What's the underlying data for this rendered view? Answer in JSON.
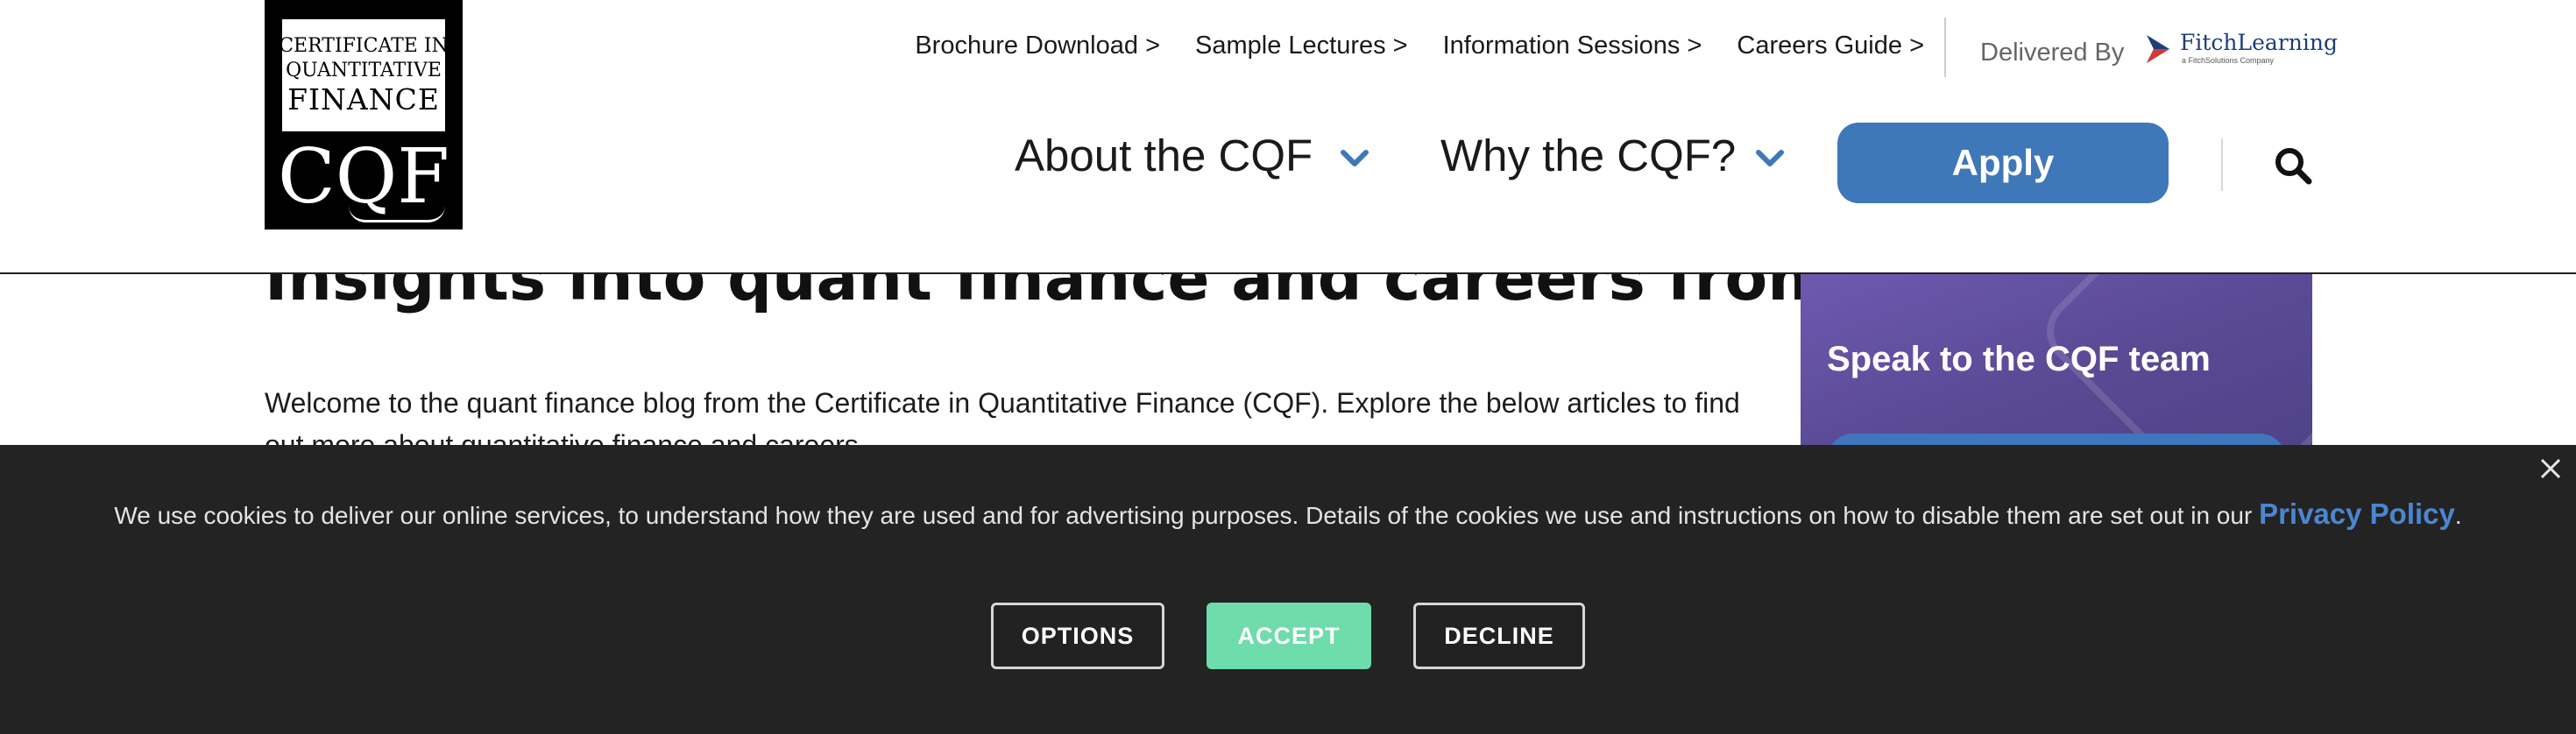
{
  "content": {
    "headline": "Insights into quant finance and careers from the CQF",
    "intro": "Welcome to the quant finance blog from the Certificate in Quantitative Finance (CQF). Explore the below articles to find out more about quantitative finance and careers.",
    "side_card_title": "Speak to the CQF team"
  },
  "header": {
    "logo": {
      "line1": "CERTIFICATE IN",
      "line2": "QUANTITATIVE",
      "line3": "FINANCE",
      "mark": "CQF"
    },
    "top_links": [
      "Brochure Download >",
      "Sample Lectures >",
      "Information Sessions >",
      "Careers Guide >"
    ],
    "delivered_by": "Delivered By",
    "partner": {
      "name": "FitchLearning",
      "tagline": "a FitchSolutions Company"
    },
    "nav": [
      {
        "label": "About the CQF",
        "icon": "chevron-down-icon"
      },
      {
        "label": "Why the CQF?",
        "icon": "chevron-down-icon"
      }
    ],
    "apply_label": "Apply",
    "search_icon": "search-icon"
  },
  "cookie_banner": {
    "text": "We use cookies to deliver our online services, to understand how they are used and for advertising purposes. Details of the cookies we use and instructions on how to disable them are set out in our",
    "link": "Privacy Policy",
    "suffix": ".",
    "buttons": {
      "options": "OPTIONS",
      "accept": "ACCEPT",
      "decline": "DECLINE"
    },
    "close_icon": "close-icon"
  },
  "colors": {
    "brand_blue": "#3f78b9",
    "accent_purple": "#6a57ab",
    "accept_green": "#6edcab",
    "banner_bg": "#232323",
    "link_blue": "#4b86cf"
  }
}
